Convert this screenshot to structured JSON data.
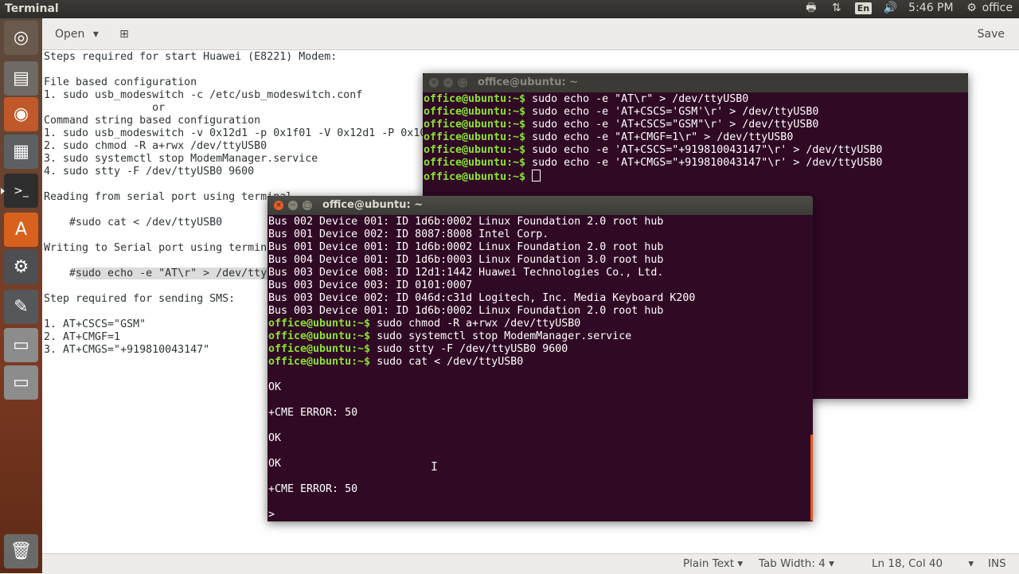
{
  "top_panel": {
    "app_title": "Terminal",
    "printer_icon": "🖶",
    "network_icon": "⇅",
    "keyboard_layout": "En",
    "volume_icon": "🔊",
    "clock": "5:46 PM",
    "settings_icon": "⚙",
    "user": "office"
  },
  "launcher": {
    "items": [
      {
        "name": "dash-home-icon",
        "glyph": "◎"
      },
      {
        "name": "files-icon",
        "glyph": "▤"
      },
      {
        "name": "firefox-icon",
        "glyph": "◉"
      },
      {
        "name": "calculator-icon",
        "glyph": "▦"
      },
      {
        "name": "terminal-icon",
        "glyph": ">_"
      },
      {
        "name": "software-center-icon",
        "glyph": "A"
      },
      {
        "name": "system-settings-icon",
        "glyph": "⚙"
      },
      {
        "name": "text-editor-icon",
        "glyph": "✎"
      },
      {
        "name": "drive-icon",
        "glyph": "▭"
      },
      {
        "name": "drive-2-icon",
        "glyph": "▭"
      },
      {
        "name": "trash-icon",
        "glyph": "🗑"
      }
    ]
  },
  "gedit": {
    "open_label": "Open",
    "open_arrow": "▾",
    "newtab_glyph": "⊞",
    "save_label": "Save",
    "lines": [
      "Steps required for start Huawei (E8221) Modem:",
      "",
      "File based configuration",
      "1. sudo usb_modeswitch -c /etc/usb_modeswitch.conf",
      "                 or",
      "Command string based configuration",
      "1. sudo usb_modeswitch -v 0x12d1 -p 0x1f01 -V 0x12d1 -P 0x1001 -M \"55534243123456780000000000000011062000000100000000000000000000\"",
      "2. sudo chmod -R a+rwx /dev/ttyUSB0",
      "3. sudo systemctl stop ModemManager.service",
      "4. sudo stty -F /dev/ttyUSB0 9600",
      "",
      "Reading from serial port using terminal",
      "",
      "    #sudo cat < /dev/ttyUSB0",
      "",
      "Writing to Serial port using terminal",
      "",
      "    #",
      "",
      "Step required for sending SMS:",
      "",
      "1. AT+CSCS=\"GSM\"",
      "2. AT+CMGF=1",
      "3. AT+CMGS=\"+919810043147\""
    ],
    "selected_line_index": 17,
    "selected_text": "sudo echo -e \"AT\\r\" > /dev/ttyUSB0",
    "status": {
      "syntax": "Plain Text",
      "tab_width": "Tab Width: 4",
      "position": "Ln 18, Col 40",
      "mode": "INS",
      "dropdown_arrow": "▾"
    }
  },
  "terminal_back": {
    "title": "office@ubuntu: ~",
    "prompt": "office@ubuntu:~$",
    "commands": [
      " sudo echo -e \"AT\\r\" > /dev/ttyUSB0",
      " sudo echo -e 'AT+CSCS='GSM'\\r' > /dev/ttyUSB0",
      " sudo echo -e 'AT+CSCS=\"GSM\"\\r' > /dev/ttyUSB0",
      " sudo echo -e \"AT+CMGF=1\\r\" > /dev/ttyUSB0",
      " sudo echo -e 'AT+CSCS=\"+919810043147\"\\r' > /dev/ttyUSB0",
      " sudo echo -e 'AT+CMGS=\"+919810043147\"\\r' > /dev/ttyUSB0",
      " "
    ]
  },
  "terminal_front": {
    "title": "office@ubuntu: ~",
    "prompt": "office@ubuntu:~$",
    "lsusb_lines": [
      "Bus 002 Device 001: ID 1d6b:0002 Linux Foundation 2.0 root hub",
      "Bus 001 Device 002: ID 8087:8008 Intel Corp.",
      "Bus 001 Device 001: ID 1d6b:0002 Linux Foundation 2.0 root hub",
      "Bus 004 Device 001: ID 1d6b:0003 Linux Foundation 3.0 root hub",
      "Bus 003 Device 008: ID 12d1:1442 Huawei Technologies Co., Ltd.",
      "Bus 003 Device 003: ID 0101:0007",
      "Bus 003 Device 002: ID 046d:c31d Logitech, Inc. Media Keyboard K200",
      "Bus 003 Device 001: ID 1d6b:0002 Linux Foundation 2.0 root hub"
    ],
    "commands": [
      " sudo chmod -R a+rwx /dev/ttyUSB0",
      " sudo systemctl stop ModemManager.service",
      " sudo stty -F /dev/ttyUSB0 9600",
      " sudo cat < /dev/ttyUSB0"
    ],
    "output": [
      "",
      "OK",
      "",
      "+CME ERROR: 50",
      "",
      "OK",
      "",
      "OK",
      "",
      "+CME ERROR: 50",
      "",
      ">"
    ]
  },
  "window_buttons": {
    "close": "×",
    "minimize": "−",
    "maximize": "□"
  },
  "colors": {
    "prompt": "#8ae234",
    "terminal_bg": "#300a24",
    "accent": "#e95420"
  }
}
